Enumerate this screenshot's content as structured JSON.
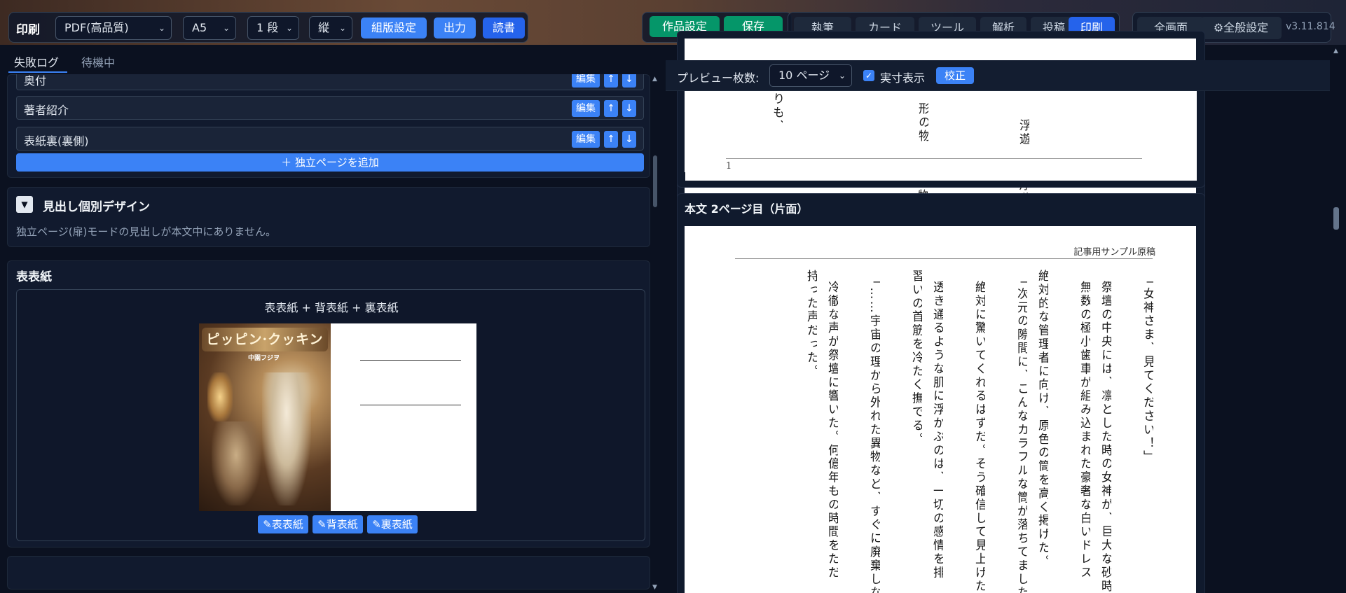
{
  "toolbar": {
    "title": "印刷",
    "format_select": "PDF(高品質)",
    "paper_select": "A5",
    "columns_select": "1 段",
    "direction_select": "縦",
    "layout_button": "組版設定",
    "output_button": "出力",
    "read_button": "読書",
    "work_settings_button": "作品設定",
    "save_button": "保存",
    "mode_tabs": [
      "執筆",
      "カード",
      "ツール",
      "解析",
      "投稿",
      "印刷"
    ],
    "active_tab": "印刷",
    "fullscreen_button": "全画面",
    "settings_button": "⚙全般設定",
    "version": "v3.11.814"
  },
  "log_tabs": {
    "failure_log": "失敗ログ",
    "pending": "待機中"
  },
  "independent_pages": {
    "items": [
      {
        "label": "奥付"
      },
      {
        "label": "著者紹介"
      },
      {
        "label": "表紙裏(裏側)"
      }
    ],
    "edit_label": "編集",
    "up_label": "↑",
    "down_label": "↓",
    "add_button": "＋ 独立ページを追加"
  },
  "heading_design": {
    "toggle": "▼",
    "title": "見出し個別デザイン",
    "message": "独立ページ(扉)モードの見出しが本文中にありません。"
  },
  "cover": {
    "section_title": "表表紙",
    "combined_title": "表表紙 + 背表紙 + 裏表紙",
    "cover_book_title": "ピッピン·クッキン",
    "cover_author": "中園フジヲ",
    "edit_front": "表表紙",
    "edit_spine": "背表紙",
    "edit_back": "裏表紙"
  },
  "preview": {
    "count_label": "プレビュー枚数:",
    "count_select": "10 ページ",
    "actual_size_label": "実寸表示",
    "actual_size_checked": true,
    "proof_button": "校正",
    "page1_fragments": [
      "りも、",
      "形の物",
      "浮遊",
      "の",
      "流",
      "面"
    ],
    "page1_number": "1",
    "page2_title": "本文 2ページ目（片面）",
    "page2_header": "記事用サンプル原稿",
    "page2_columns": [
      "「女神さま、見てください！」",
      "祭壇の中央には、凛とした時の女神が、巨大な砂時計",
      "無数の極小歯車が組み込まれた豪奢な白いドレス",
      "絶対的な管理者に向け、原色の筒を高く掲げた。",
      "「次元の隙間に、こんなカラフルな筒が落ちてました！",
      "絶対に驚いてくれるはずだ。そう確信して見上げた女",
      "透き通るような肌に浮かぶのは、一切の感情を排",
      "習いの首筋を冷たく撫でる。",
      "「……宇宙の理から外れた異物など、すぐに廃棄しなさ",
      "冷徹な声が祭壇に響いた。何億年もの時間をただ",
      "持った声だった。"
    ]
  },
  "colors": {
    "accent": "#2563eb",
    "green": "#059669",
    "panel": "#111a2e",
    "background": "#0b1120"
  },
  "icons": {
    "pencil": "pencil-icon",
    "chevron": "chevron-down-icon",
    "triangle": "triangle-down-icon"
  }
}
